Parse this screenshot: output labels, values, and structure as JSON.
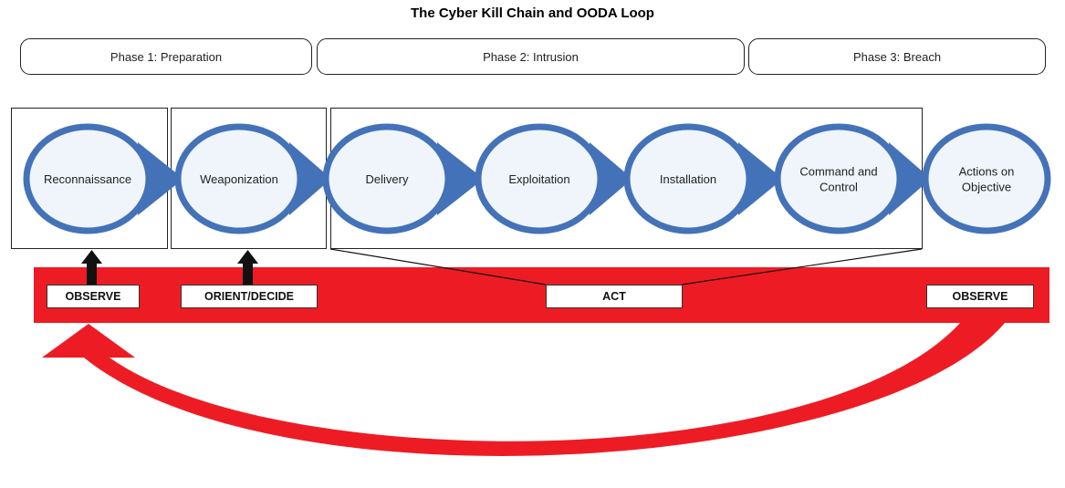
{
  "title": "The Cyber Kill Chain and OODA Loop",
  "phases": [
    {
      "label": "Phase 1: Preparation"
    },
    {
      "label": "Phase 2: Intrusion"
    },
    {
      "label": "Phase 3: Breach"
    }
  ],
  "kill_chain": [
    {
      "lines": [
        "Reconnaissance"
      ]
    },
    {
      "lines": [
        "Weaponization"
      ]
    },
    {
      "lines": [
        "Delivery"
      ]
    },
    {
      "lines": [
        "Exploitation"
      ]
    },
    {
      "lines": [
        "Installation"
      ]
    },
    {
      "lines": [
        "Command and",
        "Control"
      ]
    },
    {
      "lines": [
        "Actions on",
        "Objective"
      ]
    }
  ],
  "ooda": [
    {
      "label": "OBSERVE"
    },
    {
      "label": "ORIENT/DECIDE"
    },
    {
      "label": "ACT"
    },
    {
      "label": "OBSERVE"
    }
  ],
  "colors": {
    "ellipse_stroke": "#4472b8",
    "ellipse_fill": "#eff5fb",
    "ooda_band": "#ed1c24",
    "frame": "#222222"
  }
}
